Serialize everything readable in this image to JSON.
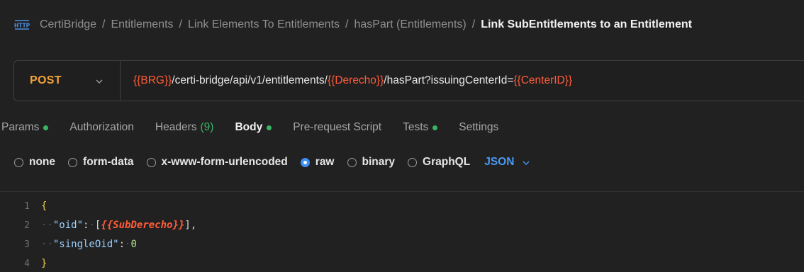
{
  "breadcrumb": {
    "items": [
      "CertiBridge",
      "Entitlements",
      "Link Elements To Entitlements",
      "hasPart (Entitlements)"
    ],
    "separator": "/",
    "current": "Link SubEntitlements to an Entitlement"
  },
  "request": {
    "method": "POST",
    "url_parts": [
      {
        "text": "{{BRG}}",
        "var": true
      },
      {
        "text": "/certi-bridge/api/v1/entitlements/",
        "var": false
      },
      {
        "text": "{{Derecho}}",
        "var": true
      },
      {
        "text": "/hasPart?issuingCenterId=",
        "var": false
      },
      {
        "text": "{{CenterID}}",
        "var": true
      }
    ]
  },
  "tabs": {
    "params": "Params",
    "authorization": "Authorization",
    "headers": "Headers",
    "headers_count": "(9)",
    "body": "Body",
    "prerequest": "Pre-request Script",
    "tests": "Tests",
    "settings": "Settings"
  },
  "body_options": {
    "none": "none",
    "form_data": "form-data",
    "urlencoded": "x-www-form-urlencoded",
    "raw": "raw",
    "binary": "binary",
    "graphql": "GraphQL",
    "language": "JSON"
  },
  "editor": {
    "line_numbers": [
      "1",
      "2",
      "3",
      "4"
    ],
    "open_brace": "{",
    "close_brace": "}",
    "key1": "\"oid\"",
    "template_var": "{{SubDerecho}}",
    "key2": "\"singleOid\"",
    "value2": "0"
  },
  "colors": {
    "background": "#212121",
    "method": "#f2a33a",
    "variable": "#ff5c3a",
    "active_dot": "#3bb365",
    "accent": "#3d8ef7"
  }
}
